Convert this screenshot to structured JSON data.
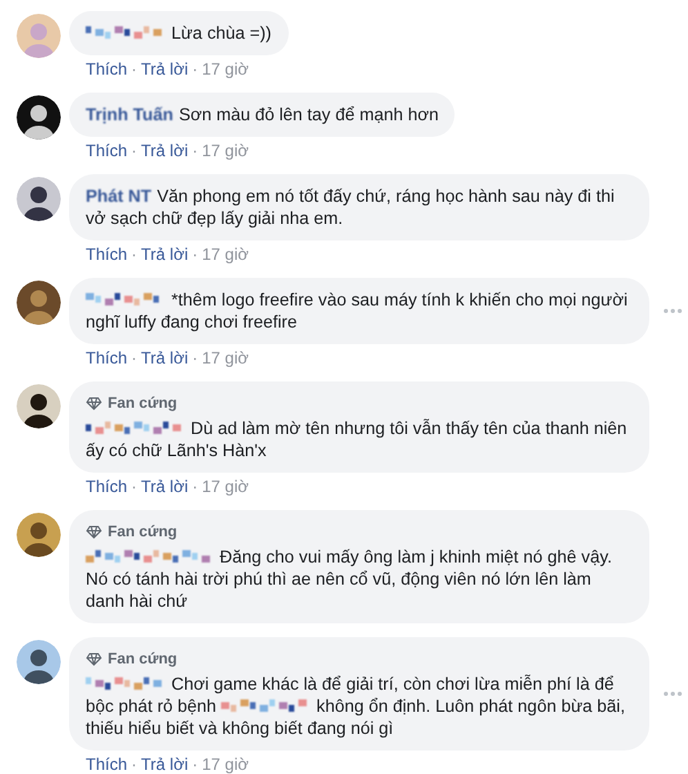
{
  "comments": [
    {
      "author": {
        "kind": "redacted"
      },
      "message": [
        {
          "kind": "text",
          "text": "Lừa chùa =))"
        }
      ],
      "actions": {
        "like": "Thích",
        "separator_1": "·",
        "reply": "Trả lời",
        "separator_2": "·",
        "time": "17 giờ"
      },
      "menu": false
    },
    {
      "author": {
        "kind": "name",
        "text": "Trịnh Tuấn"
      },
      "message": [
        {
          "kind": "text",
          "text": "Sơn màu đỏ lên tay để mạnh hơn"
        }
      ],
      "actions": {
        "like": "Thích",
        "separator_1": "·",
        "reply": "Trả lời",
        "separator_2": "·",
        "time": "17 giờ"
      },
      "menu": false
    },
    {
      "author": {
        "kind": "name",
        "text": "Phát NT"
      },
      "message": [
        {
          "kind": "text",
          "text": "Văn phong em nó tốt đấy chứ, ráng học hành sau này đi thi vở sạch chữ đẹp lấy giải nha em."
        }
      ],
      "actions": {
        "like": "Thích",
        "separator_1": "·",
        "reply": "Trả lời",
        "separator_2": "·",
        "time": "17 giờ"
      },
      "menu": false
    },
    {
      "author": {
        "kind": "redacted"
      },
      "message": [
        {
          "kind": "text",
          "text": "*thêm logo freefire vào sau máy tính k khiến cho mọi người nghĩ luffy đang chơi freefire"
        }
      ],
      "actions": {
        "like": "Thích",
        "separator_1": "·",
        "reply": "Trả lời",
        "separator_2": "·",
        "time": "17 giờ"
      },
      "menu": true
    },
    {
      "author": {
        "kind": "redacted"
      },
      "badge": "Fan cứng",
      "message": [
        {
          "kind": "text",
          "text": "Dù ad làm mờ tên nhưng tôi vẫn thấy tên của thanh niên ấy có chữ Lãnh's Hàn'x"
        }
      ],
      "actions": {
        "like": "Thích",
        "separator_1": "·",
        "reply": "Trả lời",
        "separator_2": "·",
        "time": "17 giờ"
      },
      "menu": false
    },
    {
      "author": {
        "kind": "redacted"
      },
      "badge": "Fan cứng",
      "message": [
        {
          "kind": "text",
          "text": "Đăng cho vui mấy ông làm j khinh miệt nó ghê vậy. Nó có tánh hài trời phú thì ae nên cổ vũ, động viên nó lớn lên làm danh hài chứ"
        }
      ],
      "menu": false
    },
    {
      "author": {
        "kind": "redacted"
      },
      "badge": "Fan cứng",
      "message": [
        {
          "kind": "text",
          "text": "Chơi game khác là để giải trí, còn chơi lừa miễn phí là để bộc phát rỏ bệnh"
        },
        {
          "kind": "redacted"
        },
        {
          "kind": "text",
          "text": "không ổn định. Luôn phát ngôn bừa bãi, thiếu hiểu biết và không biết đang nói gì"
        }
      ],
      "actions": {
        "like": "Thích",
        "separator_1": "·",
        "reply": "Trả lời",
        "separator_2": "·",
        "time": "17 giờ"
      },
      "menu": true
    }
  ]
}
